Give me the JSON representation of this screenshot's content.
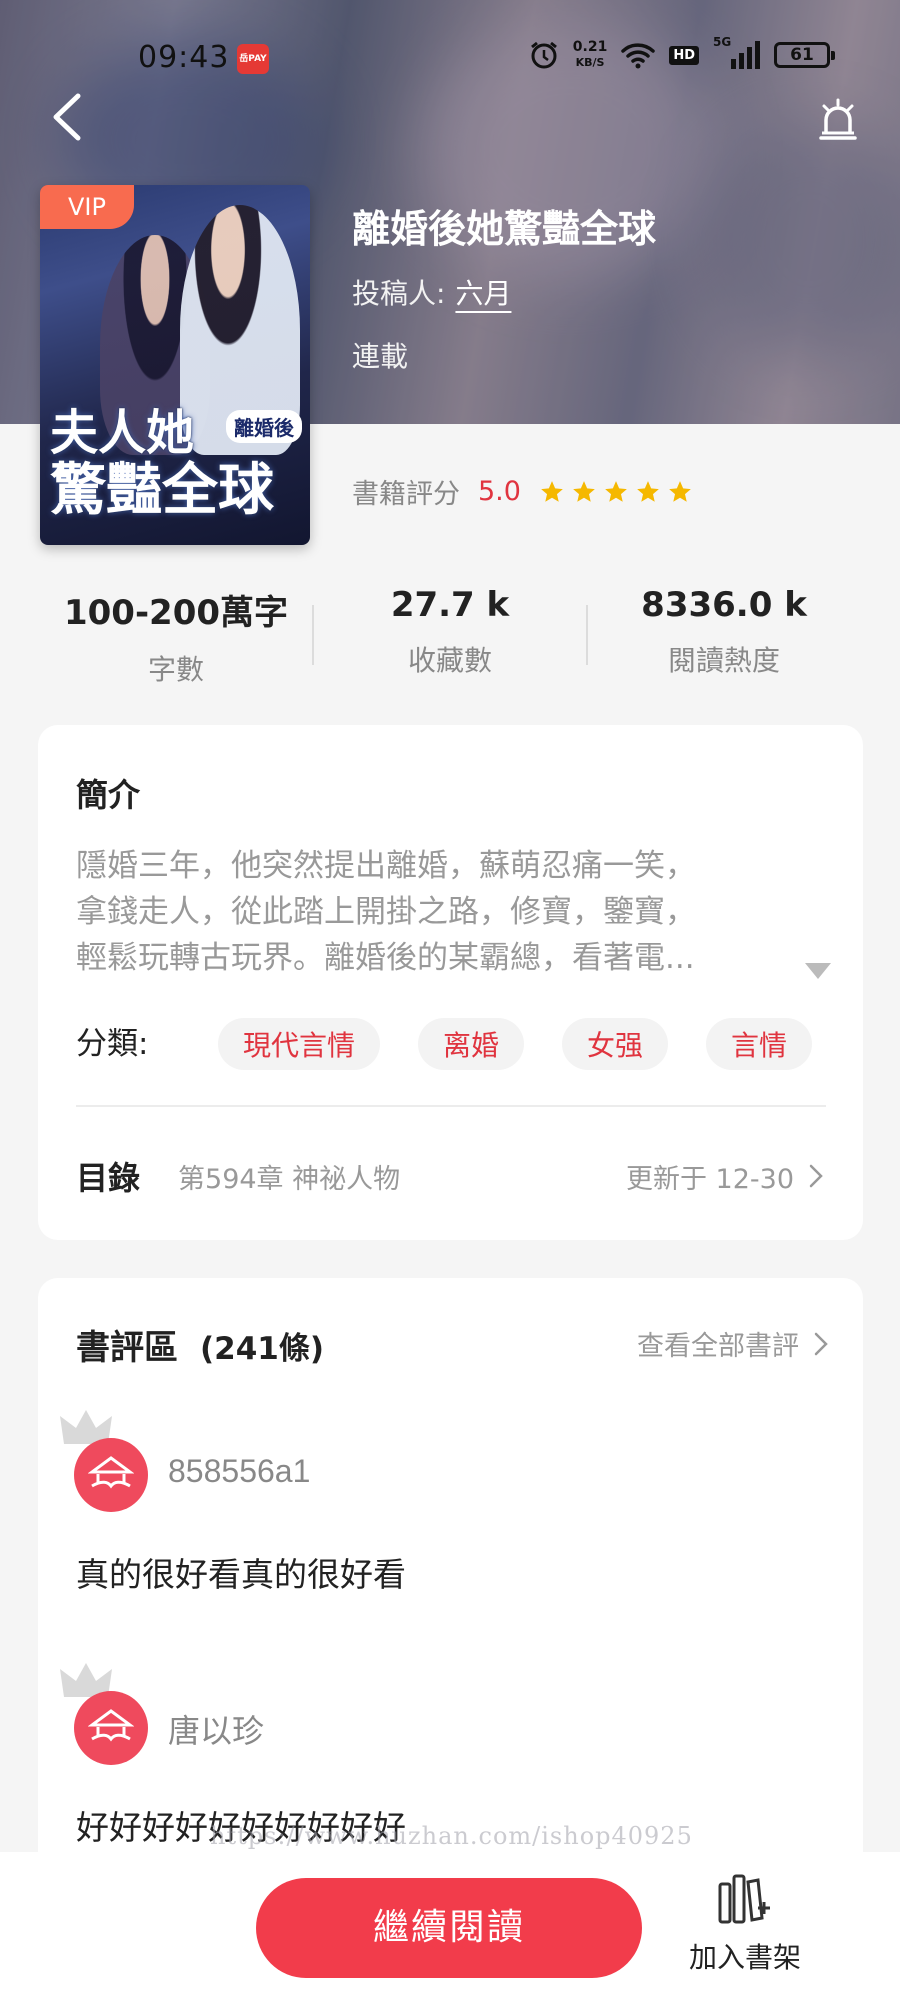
{
  "status_bar": {
    "time": "09:43",
    "app_badge": "岳PAY",
    "net_speed_value": "0.21",
    "net_speed_unit": "KB/S",
    "hd": "HD",
    "network": "5G",
    "battery": "61"
  },
  "book": {
    "vip": "VIP",
    "cover_tag": "離婚後",
    "cover_line1": "夫人她",
    "cover_line2": "驚豔全球",
    "title": "離婚後她驚豔全球",
    "author_label": "投稿人:",
    "author": "六月",
    "status": "連載",
    "rating_label": "書籍評分",
    "rating_value": "5.0",
    "stars": 5
  },
  "stats": [
    {
      "value": "100-200萬字",
      "label": "字數"
    },
    {
      "value": "27.7 k",
      "label": "收藏數"
    },
    {
      "value": "8336.0 k",
      "label": "閱讀熱度"
    }
  ],
  "intro": {
    "title": "簡介",
    "lines": [
      "隱婚三年，他突然提出離婚，蘇萌忍痛一笑，",
      "拿錢走人，從此踏上開掛之路，修寶，鑒寶，",
      "輕鬆玩轉古玩界。離婚後的某霸總，看著電..."
    ],
    "category_label": "分類:",
    "tags": [
      "現代言情",
      "离婚",
      "女强",
      "言情"
    ]
  },
  "toc": {
    "label": "目錄",
    "latest_chapter": "第594章 神祕人物",
    "updated": "更新于 12-30"
  },
  "reviews": {
    "title": "書評區",
    "count": "(241條)",
    "see_all": "查看全部書評",
    "items": [
      {
        "user": "858556a1",
        "text": "真的很好看真的很好看"
      },
      {
        "user": "唐以珍",
        "text": "好好好好好好好好好好"
      }
    ]
  },
  "watermark": "https://www.huzhan.com/ishop40925",
  "bottom": {
    "read_button": "繼續閱讀",
    "shelf_button": "加入書架"
  },
  "colors": {
    "accent": "#f23c4b",
    "rating": "#e0343f",
    "star": "#f5b800",
    "vip": "#f86b4f"
  }
}
